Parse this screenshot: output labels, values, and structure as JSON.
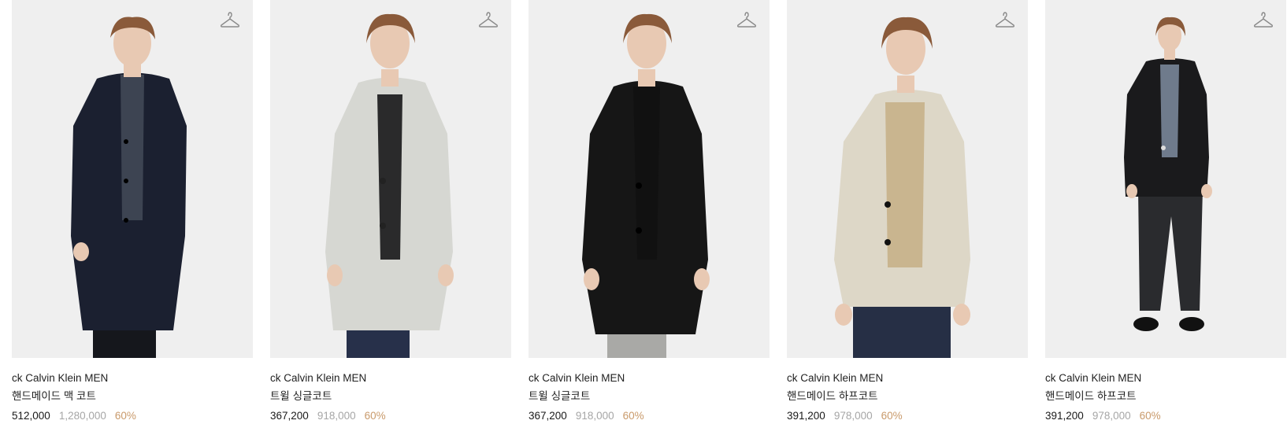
{
  "products": [
    {
      "brand": "ck Calvin Klein MEN",
      "name": "핸드메이드 맥 코트",
      "price": "512,000",
      "original_price": "1,280,000",
      "discount": "60%",
      "coat_color": "#1b2030",
      "inner_color": "#3d4452",
      "pants_color": "#15171c"
    },
    {
      "brand": "ck Calvin Klein MEN",
      "name": "트윌 싱글코트",
      "price": "367,200",
      "original_price": "918,000",
      "discount": "60%",
      "coat_color": "#d6d7d2",
      "inner_color": "#2a2a2b",
      "pants_color": "#27304a"
    },
    {
      "brand": "ck Calvin Klein MEN",
      "name": "트윌 싱글코트",
      "price": "367,200",
      "original_price": "918,000",
      "discount": "60%",
      "coat_color": "#161616",
      "inner_color": "#111111",
      "pants_color": "#a9a9a6"
    },
    {
      "brand": "ck Calvin Klein MEN",
      "name": "핸드메이드 하프코트",
      "price": "391,200",
      "original_price": "978,000",
      "discount": "60%",
      "coat_color": "#ddd7c7",
      "inner_color": "#c9b58f",
      "pants_color": "#262f45"
    },
    {
      "brand": "ck Calvin Klein MEN",
      "name": "핸드메이드 하프코트",
      "price": "391,200",
      "original_price": "978,000",
      "discount": "60%",
      "coat_color": "#1a1a1c",
      "inner_color": "#6f7b8c",
      "pants_color": "#2a2b2e"
    }
  ],
  "icons": {
    "hanger": "hanger-icon"
  },
  "colors": {
    "background": "#efefef",
    "discount": "#c99a6b",
    "original_price": "#a6a6a6",
    "hair": "#8a5a3a",
    "skin": "#e8c9b3"
  }
}
